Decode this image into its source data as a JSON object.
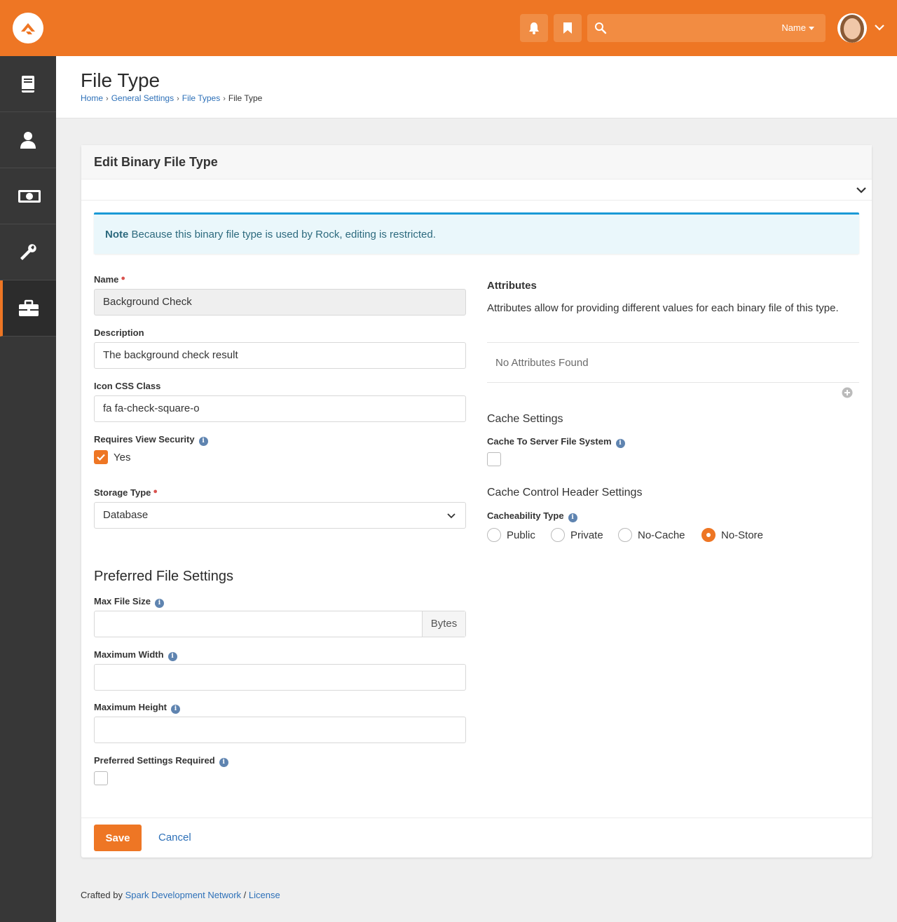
{
  "header": {
    "search_type": "Name"
  },
  "page": {
    "title": "File Type",
    "breadcrumb": [
      "Home",
      "General Settings",
      "File Types",
      "File Type"
    ]
  },
  "panel": {
    "title": "Edit Binary File Type",
    "alert_strong": "Note",
    "alert_text": " Because this binary file type is used by Rock, editing is restricted."
  },
  "form": {
    "name_label": "Name",
    "name_value": "Background Check",
    "description_label": "Description",
    "description_value": "The background check result",
    "icon_label": "Icon CSS Class",
    "icon_value": "fa fa-check-square-o",
    "requires_view_security_label": "Requires View Security",
    "requires_view_security_option": "Yes",
    "storage_type_label": "Storage Type",
    "storage_type_value": "Database",
    "preferred_title": "Preferred File Settings",
    "max_file_size_label": "Max File Size",
    "max_file_size_addon": "Bytes",
    "max_width_label": "Maximum Width",
    "max_height_label": "Maximum Height",
    "preferred_required_label": "Preferred Settings Required"
  },
  "right": {
    "attributes_title": "Attributes",
    "attributes_desc": "Attributes allow for providing different values for each binary file of this type.",
    "no_attributes": "No Attributes Found",
    "cache_settings_title": "Cache Settings",
    "cache_to_server_label": "Cache To Server File System",
    "cache_control_title": "Cache Control Header Settings",
    "cacheability_label": "Cacheability Type",
    "cacheability_options": [
      "Public",
      "Private",
      "No-Cache",
      "No-Store"
    ],
    "cacheability_selected": "No-Store"
  },
  "actions": {
    "save": "Save",
    "cancel": "Cancel"
  },
  "footer": {
    "crafted_by": "Crafted by ",
    "org": "Spark Development Network",
    "sep": " / ",
    "license": "License"
  },
  "colors": {
    "brand": "#ee7624",
    "link": "#2d70b8",
    "sidebar": "#373737",
    "alert_border": "#1a9ad6"
  },
  "icons": {
    "sidebar": [
      "book-icon",
      "person-icon",
      "money-icon",
      "wrench-icon",
      "briefcase-icon"
    ],
    "header": [
      "bell-icon",
      "bookmark-icon",
      "search-icon"
    ]
  }
}
